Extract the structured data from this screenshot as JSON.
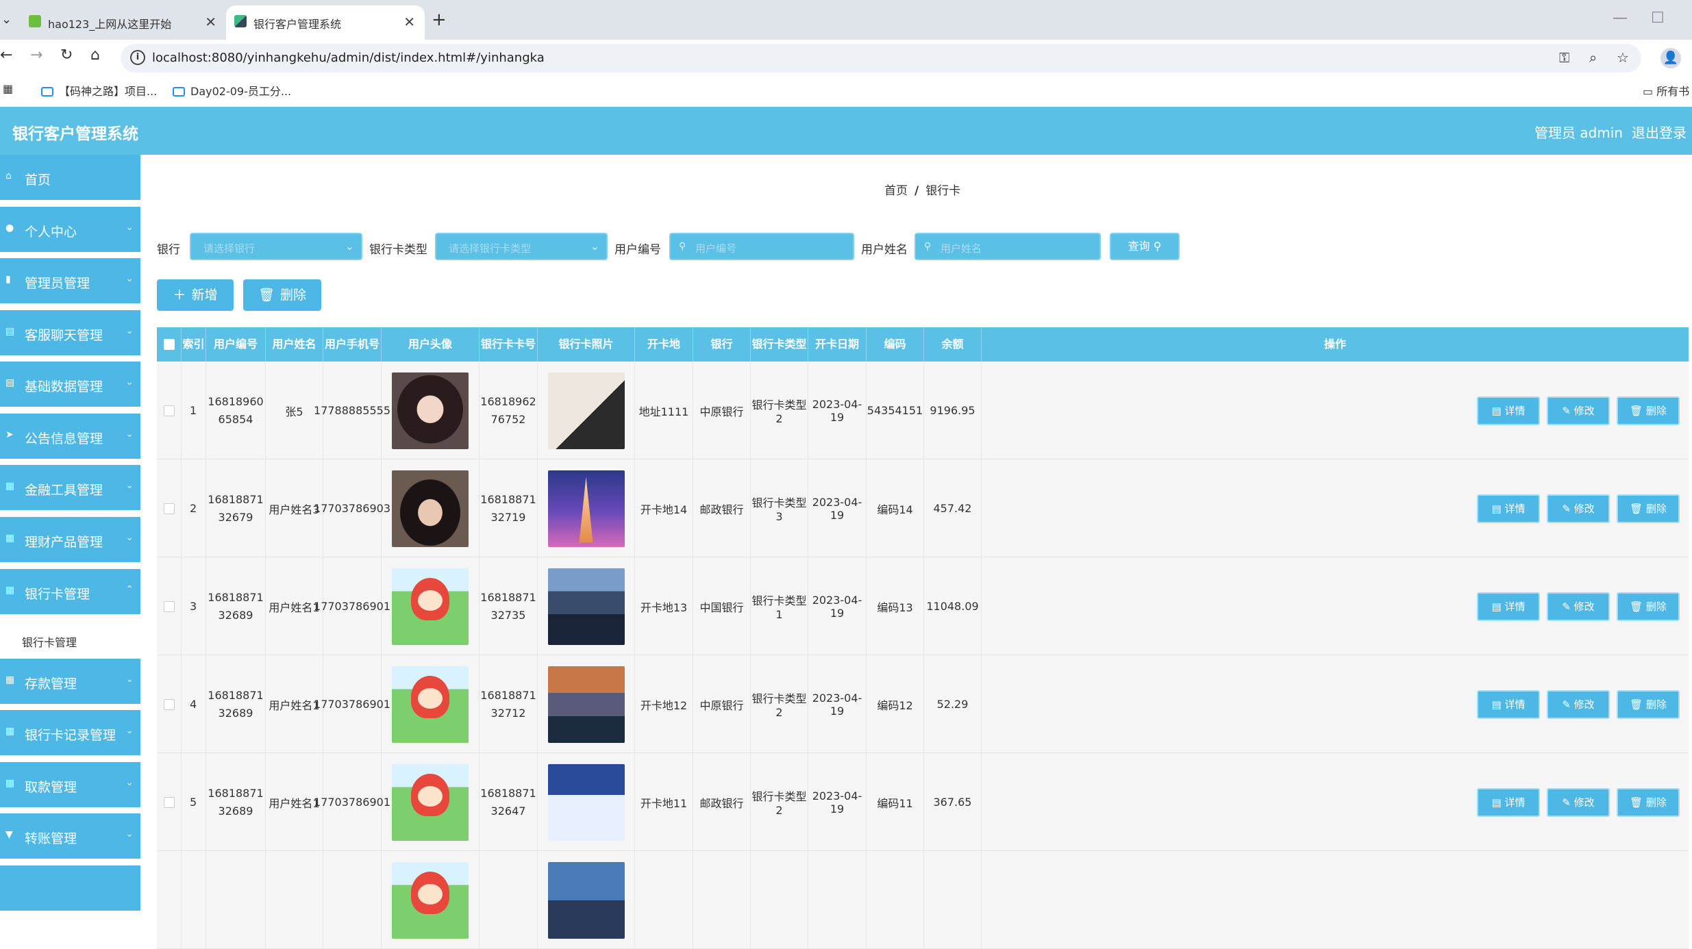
{
  "browser": {
    "tabs": [
      {
        "title": "hao123_上网从这里开始",
        "close": "✕"
      },
      {
        "title": "银行客户管理系统",
        "close": "✕"
      }
    ],
    "new_tab": "+",
    "url": "localhost:8080/yinhangkehu/admin/dist/index.html#/yinhangka",
    "bookmarks": [
      "【码神之路】项目...",
      "Day02-09-员工分..."
    ],
    "all_bookmarks": "所有书"
  },
  "app": {
    "title": "银行客户管理系统",
    "admin_label": "管理员 admin",
    "logout": "退出登录"
  },
  "sidebar": {
    "items": [
      {
        "label": "首页",
        "icon": "⌂"
      },
      {
        "label": "个人中心",
        "icon": "●"
      },
      {
        "label": "管理员管理",
        "icon": "▮"
      },
      {
        "label": "客服聊天管理",
        "icon": "▤"
      },
      {
        "label": "基础数据管理",
        "icon": "▤"
      },
      {
        "label": "公告信息管理",
        "icon": "➤"
      },
      {
        "label": "金融工具管理",
        "icon": "▦"
      },
      {
        "label": "理财产品管理",
        "icon": "▦"
      },
      {
        "label": "银行卡管理",
        "icon": "▦"
      },
      {
        "label": "存款管理",
        "icon": "▦"
      },
      {
        "label": "银行卡记录管理",
        "icon": "▦"
      },
      {
        "label": "取款管理",
        "icon": "▦"
      },
      {
        "label": "转账管理",
        "icon": "▼"
      }
    ],
    "submenu": "银行卡管理"
  },
  "breadcrumb": {
    "home": "首页",
    "sep": "/",
    "current": "银行卡"
  },
  "filters": {
    "bank_label": "银行",
    "bank_placeholder": "请选择银行",
    "card_type_label": "银行卡类型",
    "card_type_placeholder": "请选择银行卡类型",
    "user_no_label": "用户编号",
    "user_no_placeholder": "用户编号",
    "user_name_label": "用户姓名",
    "user_name_placeholder": "用户姓名",
    "query": "查询"
  },
  "actions": {
    "add": "新增",
    "delete": "删除"
  },
  "table": {
    "headers": [
      "索引",
      "用户编号",
      "用户姓名",
      "用户手机号",
      "用户头像",
      "银行卡卡号",
      "银行卡照片",
      "开卡地",
      "银行",
      "银行卡类型",
      "开卡日期",
      "编码",
      "余额",
      "操作"
    ],
    "row_buttons": {
      "detail": "详情",
      "edit": "修改",
      "delete": "删除"
    },
    "rows": [
      {
        "index": "1",
        "user_no": "1681896065854",
        "user_name": "张5",
        "phone": "17788885555",
        "avatar": "girl",
        "card_no": "1681896276752",
        "photo": "painting",
        "place": "地址1111",
        "bank": "中原银行",
        "type": "银行卡类型2",
        "date": "2023-04-19",
        "code": "54354151",
        "balance": "9196.95"
      },
      {
        "index": "2",
        "user_no": "1681887132679",
        "user_name": "用户姓名3",
        "phone": "17703786903",
        "avatar": "boy",
        "card_no": "1681887132719",
        "photo": "tower",
        "place": "开卡地14",
        "bank": "邮政银行",
        "type": "银行卡类型3",
        "date": "2023-04-19",
        "code": "编码14",
        "balance": "457.42"
      },
      {
        "index": "3",
        "user_no": "1681887132689",
        "user_name": "用户姓名1",
        "phone": "17703786901",
        "avatar": "cartoon",
        "card_no": "1681887132735",
        "photo": "city",
        "place": "开卡地13",
        "bank": "中国银行",
        "type": "银行卡类型1",
        "date": "2023-04-19",
        "code": "编码13",
        "balance": "11048.09"
      },
      {
        "index": "4",
        "user_no": "1681887132689",
        "user_name": "用户姓名1",
        "phone": "17703786901",
        "avatar": "cartoon",
        "card_no": "1681887132712",
        "photo": "sunset",
        "place": "开卡地12",
        "bank": "中原银行",
        "type": "银行卡类型2",
        "date": "2023-04-19",
        "code": "编码12",
        "balance": "52.29"
      },
      {
        "index": "5",
        "user_no": "1681887132689",
        "user_name": "用户姓名1",
        "phone": "17703786901",
        "avatar": "cartoon",
        "card_no": "1681887132647",
        "photo": "snow",
        "place": "开卡地11",
        "bank": "邮政银行",
        "type": "银行卡类型2",
        "date": "2023-04-19",
        "code": "编码11",
        "balance": "367.65"
      },
      {
        "index": "",
        "user_no": "",
        "user_name": "",
        "phone": "",
        "avatar": "cartoon",
        "card_no": "",
        "photo": "mountain",
        "place": "",
        "bank": "",
        "type": "",
        "date": "",
        "code": "",
        "balance": ""
      }
    ]
  },
  "colors": {
    "primary": "#4db8e6",
    "header": "#5bc0e6"
  }
}
